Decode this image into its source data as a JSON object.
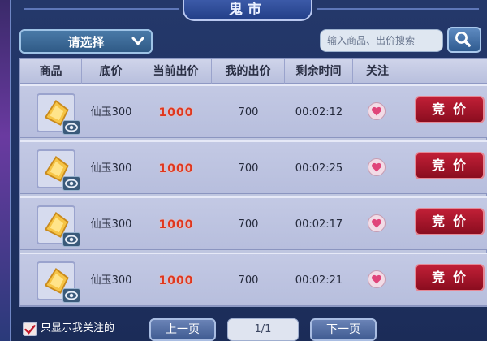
{
  "header": {
    "title": "鬼市"
  },
  "filter": {
    "category_select": "请选择",
    "search_placeholder": "输入商品、出价搜索"
  },
  "table": {
    "columns": [
      "商品",
      "底价",
      "当前出价",
      "我的出价",
      "剩余时间",
      "关注"
    ],
    "rows": [
      {
        "name": "仙玉300",
        "current_bid": "1000",
        "my_bid": "700",
        "time_left": "00:02:12",
        "action": "竞价"
      },
      {
        "name": "仙玉300",
        "current_bid": "1000",
        "my_bid": "700",
        "time_left": "00:02:25",
        "action": "竞价"
      },
      {
        "name": "仙玉300",
        "current_bid": "1000",
        "my_bid": "700",
        "time_left": "00:02:17",
        "action": "竞价"
      },
      {
        "name": "仙玉300",
        "current_bid": "1000",
        "my_bid": "700",
        "time_left": "00:02:21",
        "action": "竞价"
      }
    ]
  },
  "footer": {
    "show_followed_label": "只显示我关注的",
    "show_followed_checked": true,
    "prev_label": "上一页",
    "page_indicator": "1/1",
    "next_label": "下一页"
  },
  "colors": {
    "accent_red": "#a8142a",
    "price_red": "#e0361e",
    "panel_blue": "#1f3263",
    "heart_pink": "#e0457a"
  }
}
